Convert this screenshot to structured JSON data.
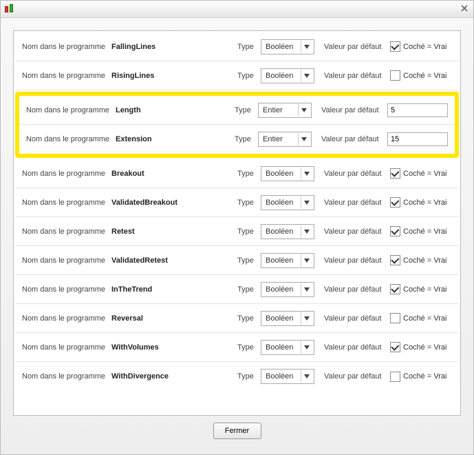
{
  "labels": {
    "name": "Nom dans le programme",
    "type": "Type",
    "default": "Valeur par défaut",
    "checkedTrue": "Coché = Vrai"
  },
  "typeOptions": {
    "boolean": "Booléen",
    "integer": "Entier"
  },
  "footer": {
    "close": "Fermer"
  },
  "rows": [
    {
      "name": "FallingLines",
      "type": "boolean",
      "checked": true,
      "highlightGroup": 0
    },
    {
      "name": "RisingLines",
      "type": "boolean",
      "checked": false,
      "highlightGroup": 0
    },
    {
      "name": "Length",
      "type": "integer",
      "value": "5",
      "highlightGroup": 1
    },
    {
      "name": "Extension",
      "type": "integer",
      "value": "15",
      "highlightGroup": 1
    },
    {
      "name": "Breakout",
      "type": "boolean",
      "checked": true,
      "highlightGroup": 0
    },
    {
      "name": "ValidatedBreakout",
      "type": "boolean",
      "checked": true,
      "highlightGroup": 0
    },
    {
      "name": "Retest",
      "type": "boolean",
      "checked": true,
      "highlightGroup": 0
    },
    {
      "name": "ValidatedRetest",
      "type": "boolean",
      "checked": true,
      "highlightGroup": 0
    },
    {
      "name": "InTheTrend",
      "type": "boolean",
      "checked": true,
      "highlightGroup": 0
    },
    {
      "name": "Reversal",
      "type": "boolean",
      "checked": false,
      "highlightGroup": 0
    },
    {
      "name": "WithVolumes",
      "type": "boolean",
      "checked": true,
      "highlightGroup": 0
    },
    {
      "name": "WithDivergence",
      "type": "boolean",
      "checked": false,
      "highlightGroup": 0
    }
  ]
}
